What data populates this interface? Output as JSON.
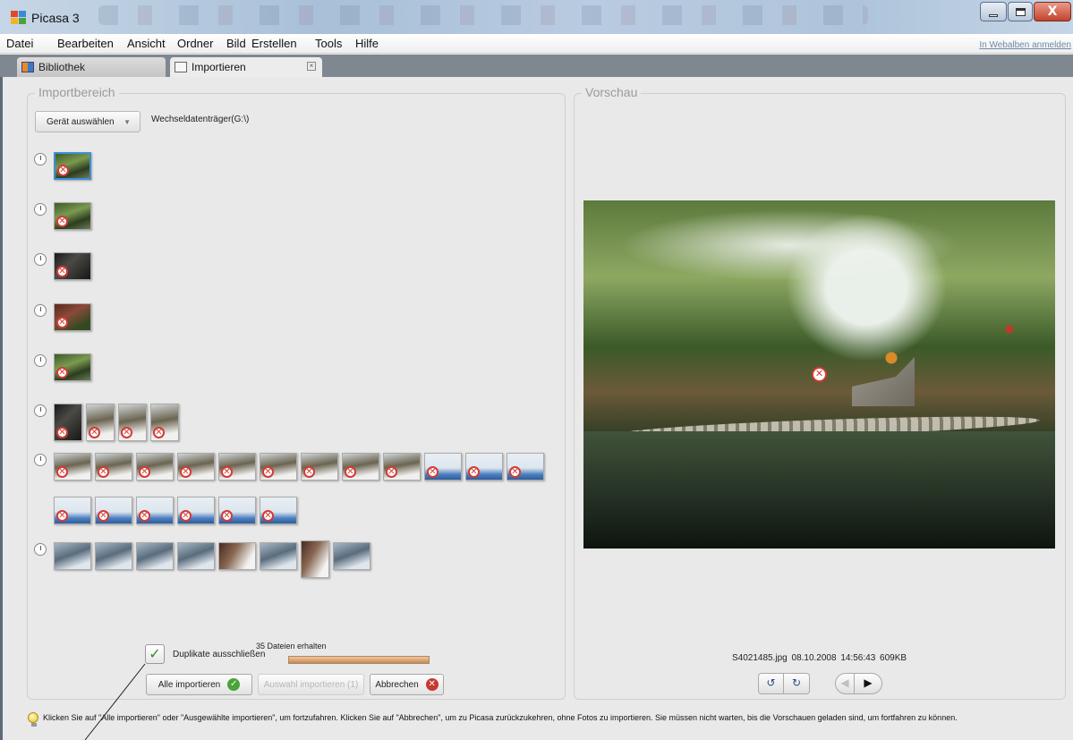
{
  "window": {
    "title": "Picasa 3",
    "controls": {
      "minimize": "minimize",
      "maximize": "maximize",
      "close": "X"
    }
  },
  "menu": {
    "items": [
      "Datei",
      "Bearbeiten",
      "Ansicht",
      "Ordner",
      "Bild",
      "Erstellen",
      "Tools",
      "Hilfe"
    ],
    "web_albums_link": "In Webalben anmelden"
  },
  "tabs": [
    {
      "label": "Bibliothek",
      "icon": "library-icon",
      "active": false
    },
    {
      "label": "Importieren",
      "icon": "import-icon",
      "active": true,
      "close": "×"
    }
  ],
  "import_area": {
    "legend": "Importbereich",
    "device_button": "Gerät auswählen",
    "device_path": "Wechseldatenträger(G:\\)",
    "groups": [
      {
        "icon": "clock-icon",
        "thumbs": [
          {
            "kind": "garden",
            "excluded": true,
            "selected": true
          }
        ]
      },
      {
        "icon": "clock-icon",
        "thumbs": [
          {
            "kind": "garden",
            "excluded": true
          }
        ]
      },
      {
        "icon": "clock-icon",
        "thumbs": [
          {
            "kind": "dark",
            "excluded": true
          }
        ]
      },
      {
        "icon": "clock-icon",
        "thumbs": [
          {
            "kind": "red",
            "excluded": true
          }
        ]
      },
      {
        "icon": "clock-icon",
        "thumbs": [
          {
            "kind": "garden",
            "excluded": true
          }
        ]
      },
      {
        "icon": "clock-icon",
        "thumbs": [
          {
            "kind": "dark",
            "excluded": true,
            "portrait": true
          },
          {
            "kind": "snowtree",
            "excluded": true,
            "portrait": true
          },
          {
            "kind": "snowtree",
            "excluded": true,
            "portrait": true
          },
          {
            "kind": "snowtree",
            "excluded": true,
            "portrait": true
          }
        ]
      },
      {
        "icon": "clock-icon",
        "thumbs": [
          {
            "kind": "snowtree",
            "excluded": true
          },
          {
            "kind": "snowtree",
            "excluded": true
          },
          {
            "kind": "snowtree",
            "excluded": true
          },
          {
            "kind": "snowtree",
            "excluded": true
          },
          {
            "kind": "snowtree",
            "excluded": true
          },
          {
            "kind": "snowtree",
            "excluded": true
          },
          {
            "kind": "snowtree",
            "excluded": true
          },
          {
            "kind": "snowtree",
            "excluded": true
          },
          {
            "kind": "snowtree",
            "excluded": true
          },
          {
            "kind": "cross",
            "excluded": true
          },
          {
            "kind": "cross",
            "excluded": true
          },
          {
            "kind": "cross",
            "excluded": true
          },
          {
            "kind": "cross",
            "excluded": true,
            "wrap": true
          },
          {
            "kind": "cross",
            "excluded": true
          },
          {
            "kind": "cross",
            "excluded": true
          },
          {
            "kind": "cross",
            "excluded": true
          },
          {
            "kind": "cross",
            "excluded": true
          },
          {
            "kind": "cross",
            "excluded": true
          }
        ]
      },
      {
        "icon": "clock-icon",
        "thumbs": [
          {
            "kind": "snow",
            "excluded": false
          },
          {
            "kind": "snow",
            "excluded": false
          },
          {
            "kind": "snow",
            "excluded": false
          },
          {
            "kind": "snow",
            "excluded": false
          },
          {
            "kind": "wood",
            "excluded": false
          },
          {
            "kind": "snow",
            "excluded": false
          },
          {
            "kind": "wood",
            "excluded": false,
            "portrait": true
          },
          {
            "kind": "snow",
            "excluded": false
          }
        ]
      }
    ],
    "exclude_duplicates_label": "Duplikate ausschließen",
    "exclude_duplicates_checked": true,
    "files_received": "35 Dateien erhalten",
    "progress": 1.0,
    "buttons": {
      "import_all": "Alle importieren",
      "import_selected": "Auswahl importieren (1)",
      "cancel": "Abbrechen"
    }
  },
  "preview": {
    "legend": "Vorschau",
    "file_info": "S4021485.jpg   08.10.2008 14:56:43   609KB",
    "controls": [
      "rotate-left-icon",
      "rotate-right-icon",
      "previous-icon",
      "next-icon"
    ]
  },
  "hint": {
    "icon": "lightbulb-icon",
    "text": "Klicken Sie auf \"Alle importieren\" oder \"Ausgewählte importieren\", um fortzufahren. Klicken Sie auf \"Abbrechen\", um zu Picasa zurückzukehren, ohne Fotos zu importieren. Sie müssen nicht warten, bis die Vorschauen geladen sind, um fortfahren zu können."
  },
  "colors": {
    "accent_selection": "#3b8fd9",
    "excluded_mark": "#d23b34",
    "ok_green": "#4aa33a",
    "cancel_red": "#c7392f"
  }
}
